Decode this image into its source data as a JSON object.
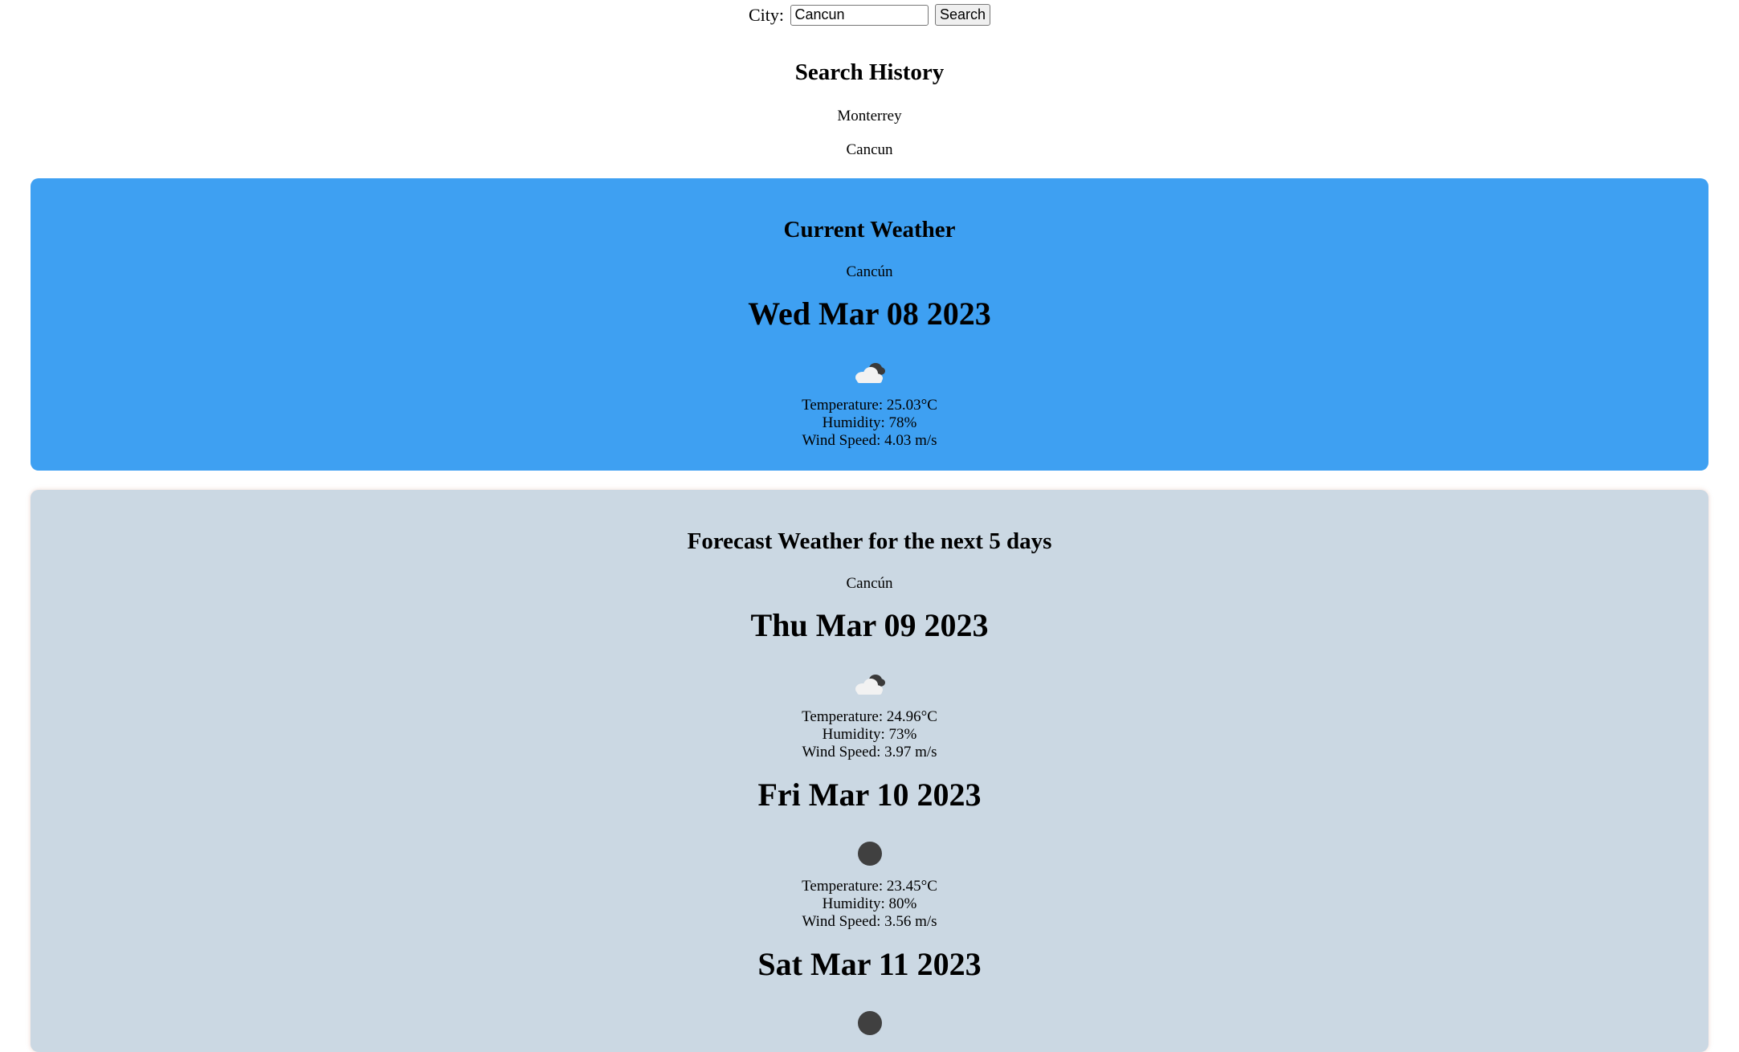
{
  "search": {
    "label": "City:",
    "value": "Cancun",
    "button_label": "Search"
  },
  "history": {
    "title": "Search History",
    "items": [
      "Monterrey",
      "Cancun"
    ]
  },
  "current": {
    "title": "Current Weather",
    "city": "Cancún",
    "date": "Wed Mar 08 2023",
    "icon": "scattered-clouds-icon",
    "temperature": "Temperature: 25.03°C",
    "humidity": "Humidity: 78%",
    "wind": "Wind Speed: 4.03 m/s"
  },
  "forecast": {
    "title": "Forecast Weather for the next 5 days",
    "city": "Cancún",
    "days": [
      {
        "date": "Thu Mar 09 2023",
        "icon": "scattered-clouds-icon",
        "temperature": "Temperature: 24.96°C",
        "humidity": "Humidity: 73%",
        "wind": "Wind Speed: 3.97 m/s"
      },
      {
        "date": "Fri Mar 10 2023",
        "icon": "overcast-clouds-icon",
        "temperature": "Temperature: 23.45°C",
        "humidity": "Humidity: 80%",
        "wind": "Wind Speed: 3.56 m/s"
      },
      {
        "date": "Sat Mar 11 2023",
        "icon": "overcast-clouds-icon"
      }
    ]
  },
  "colors": {
    "current_bg": "#3ea0f2",
    "forecast_bg": "#cbd8e3"
  }
}
